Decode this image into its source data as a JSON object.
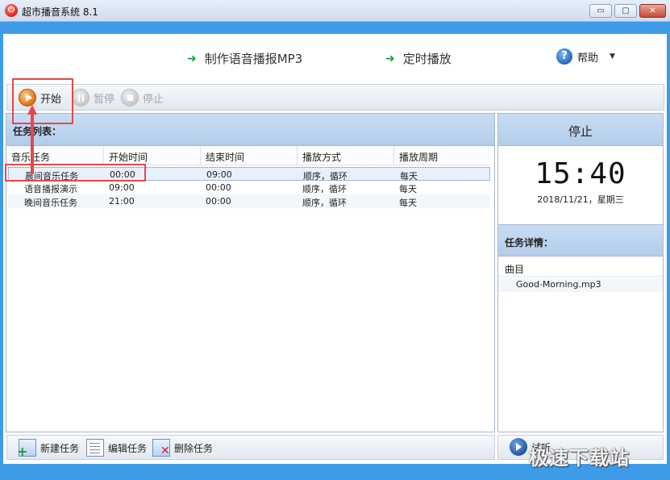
{
  "window": {
    "title": "超市播音系统 8.1",
    "minimize": "▭",
    "maximize": "▢",
    "close": "✕"
  },
  "header": {
    "make_mp3": "制作语音播报MP3",
    "timed_play": "定时播放",
    "help": "帮助",
    "arrow": "➜",
    "help_icon": "?",
    "caret": "▼"
  },
  "toolbar": {
    "start": "开始",
    "pause": "暂停",
    "stop": "停止"
  },
  "task_list": {
    "title": "任务列表：",
    "columns": [
      "音乐任务",
      "开始时间",
      "结束时间",
      "播放方式",
      "播放周期"
    ],
    "rows": [
      {
        "name": "晨间音乐任务",
        "start": "00:00",
        "end": "09:00",
        "mode": "顺序，循环",
        "period": "每天"
      },
      {
        "name": "语音播报演示",
        "start": "09:00",
        "end": "00:00",
        "mode": "顺序，循环",
        "period": "每天"
      },
      {
        "name": "晚间音乐任务",
        "start": "21:00",
        "end": "00:00",
        "mode": "顺序，循环",
        "period": "每天"
      }
    ]
  },
  "bottom_toolbar": {
    "new_task": "新建任务",
    "edit_task": "编辑任务",
    "delete_task": "删除任务"
  },
  "status": {
    "state": "停止",
    "clock": "15:40",
    "date": "2018/11/21，星期三",
    "detail_title": "任务详情：",
    "detail_column": "曲目",
    "track": "Good-Morning.mp3",
    "play_button": "试听"
  },
  "watermark": "极速下载站",
  "colors": {
    "blue_band": "#3d9be8",
    "highlight": "#e5484a",
    "panel_head": "#b2cdeb"
  }
}
